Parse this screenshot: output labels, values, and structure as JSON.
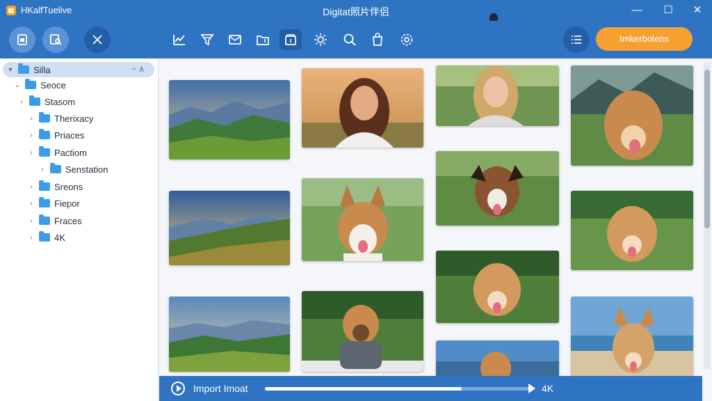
{
  "titlebar": {
    "app_name": "HKalfTuelive",
    "window_title": "Digitat照片伴侣",
    "minimize": "—",
    "maximize": "☐",
    "close": "✕"
  },
  "toolbar": {
    "left_buttons": [
      "device-icon",
      "photo-search-icon",
      "close-icon"
    ],
    "tools": [
      "stats-icon",
      "filter-icon",
      "mail-icon",
      "folder-share-icon",
      "album-icon",
      "brightness-icon",
      "search-icon",
      "bag-icon",
      "settings-icon"
    ],
    "active_tool": "album-icon",
    "right_button": "list-icon",
    "primary_label": "Imkerbolens"
  },
  "sidebar": {
    "items": [
      {
        "label": "Silla",
        "level": 0,
        "expanded": true,
        "selected": true,
        "actions": "−   ∧"
      },
      {
        "label": "Seoce",
        "level": 1,
        "expanded": true
      },
      {
        "label": "Stasom",
        "level": 1,
        "expanded": false
      },
      {
        "label": "Therixacy",
        "level": 2,
        "expanded": false
      },
      {
        "label": "Priaces",
        "level": 2,
        "expanded": false
      },
      {
        "label": "Pactiom",
        "level": 2,
        "expanded": false
      },
      {
        "label": "Senstation",
        "level": 3,
        "expanded": false
      },
      {
        "label": "Sreons",
        "level": 2,
        "expanded": false
      },
      {
        "label": "Fiepor",
        "level": 2,
        "expanded": false
      },
      {
        "label": "Fraces",
        "level": 2,
        "expanded": false
      },
      {
        "label": "4K",
        "level": 2,
        "expanded": false
      }
    ]
  },
  "photos": [
    {
      "subject": "mountain-landscape"
    },
    {
      "subject": "woman-portrait"
    },
    {
      "subject": "woman-portrait"
    },
    {
      "subject": "golden-dog"
    },
    {
      "subject": "mountain-landscape"
    },
    {
      "subject": "husky-dog"
    },
    {
      "subject": "brown-dog"
    },
    {
      "subject": "golden-dog"
    },
    {
      "subject": "mountain-landscape"
    },
    {
      "subject": "dog-in-vest"
    },
    {
      "subject": "golden-dog"
    },
    {
      "subject": "beach-dog"
    },
    {
      "subject": "dog-small"
    },
    {
      "subject": "lake-dog"
    }
  ],
  "bottombar": {
    "import_label": "Import Imoat",
    "progress": 0.74,
    "resolution_label": "4K"
  },
  "colors": {
    "chrome_blue": "#2f73c3",
    "accent_orange": "#f6a032",
    "folder_blue": "#3d9be9"
  }
}
